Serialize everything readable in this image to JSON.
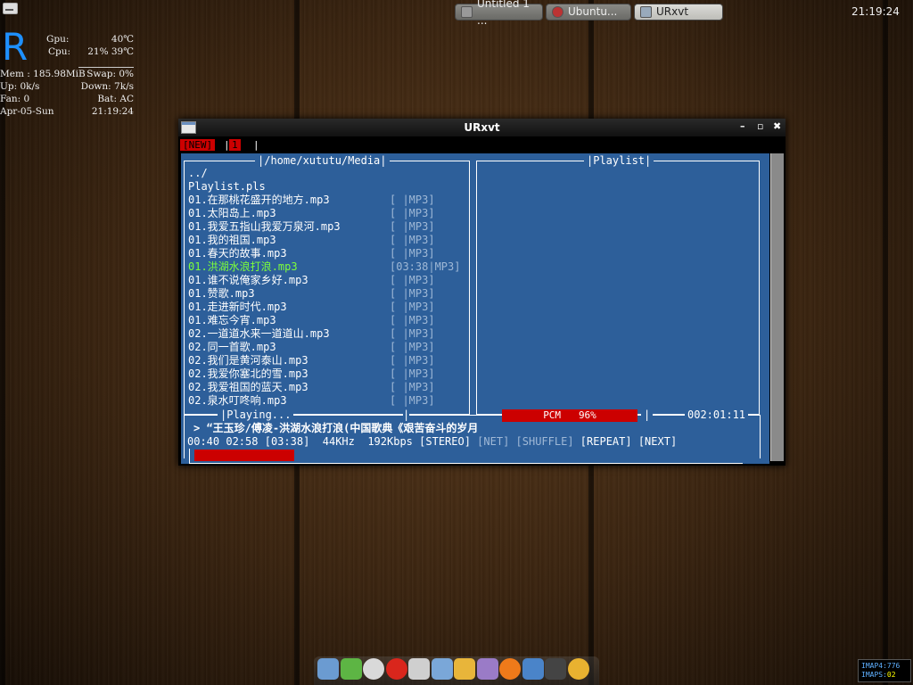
{
  "desktop": {
    "clock": "21:19:24",
    "taskbar": [
      {
        "label": "Untitled 1 ...",
        "icon": "document-icon",
        "active": false
      },
      {
        "label": "Ubuntu...",
        "icon": "ubuntu-icon",
        "active": false
      },
      {
        "label": "URxvt",
        "icon": "terminal-icon",
        "active": true
      }
    ]
  },
  "conky": {
    "logo": "R",
    "gpu_label": "Gpu:",
    "gpu_value": "40℃",
    "cpu_label": "Cpu:",
    "cpu_value": "21% 39℃",
    "mem_label": "Mem : 185.98MiB",
    "swap_label": "Swap: 0%",
    "up_label": "Up: 0k/s",
    "down_label": "Down: 7k/s",
    "fan_label": "Fan: 0",
    "bat_label": "Bat: AC",
    "date": "Apr-05-Sun",
    "time": "21:19:24"
  },
  "window": {
    "title": "URxvt",
    "tabs": [
      "NEW",
      "1"
    ]
  },
  "browser": {
    "title": "/home/xututu/Media",
    "rows": [
      {
        "name": "../",
        "tag": "",
        "current": false
      },
      {
        "name": "Playlist.pls",
        "tag": "",
        "current": false
      },
      {
        "name": "01.在那桃花盛开的地方.mp3",
        "tag": "[      |MP3]",
        "current": false
      },
      {
        "name": "01.太阳岛上.mp3",
        "tag": "[      |MP3]",
        "current": false
      },
      {
        "name": "01.我爱五指山我爱万泉河.mp3",
        "tag": "[      |MP3]",
        "current": false
      },
      {
        "name": "01.我的祖国.mp3",
        "tag": "[      |MP3]",
        "current": false
      },
      {
        "name": "01.春天的故事.mp3",
        "tag": "[      |MP3]",
        "current": false
      },
      {
        "name_hl": "01.洪湖水浪打浪",
        "name": ".mp3",
        "tag": "[03:38|MP3]",
        "current": true
      },
      {
        "name": "01.谁不说俺家乡好.mp3",
        "tag": "[      |MP3]",
        "current": false
      },
      {
        "name": "01.赞歌.mp3",
        "tag": "[      |MP3]",
        "current": false
      },
      {
        "name": "01.走进新时代.mp3",
        "tag": "[      |MP3]",
        "current": false
      },
      {
        "name": "01.难忘今宵.mp3",
        "tag": "[      |MP3]",
        "current": false
      },
      {
        "name": "02.一道道水来一道道山.mp3",
        "tag": "[      |MP3]",
        "current": false
      },
      {
        "name": "02.同一首歌.mp3",
        "tag": "[      |MP3]",
        "current": false
      },
      {
        "name": "02.我们是黄河泰山.mp3",
        "tag": "[      |MP3]",
        "current": false
      },
      {
        "name": "02.我爱你塞北的雪.mp3",
        "tag": "[      |MP3]",
        "current": false
      },
      {
        "name": "02.我爱祖国的蓝天.mp3",
        "tag": "[      |MP3]",
        "current": false
      },
      {
        "name": "02.泉水叮咚响.mp3",
        "tag": "[      |MP3]",
        "current": false
      }
    ]
  },
  "playlist": {
    "title": "Playlist"
  },
  "status": {
    "playing_label": "Playing...",
    "volume_label": "PCM",
    "volume_value": "96%",
    "volume_fraction": 0.96,
    "total_time": "002:01:11",
    "now_playing": "> “王玉珍/傅凌-洪湖水浪打浪(中国歌典《艰苦奋斗的岁月",
    "elapsed": "00:40",
    "remaining": "02:58",
    "duration": "[03:38]",
    "samplerate": "44KHz",
    "bitrate": "192Kbps",
    "flag_stereo": "[STEREO]",
    "flag_net": "[NET]",
    "flag_shuffle": "[SHUFFLE]",
    "flag_repeat": "[REPEAT]",
    "flag_next": "[NEXT]",
    "progress_fraction": 0.18
  },
  "imap": {
    "line1_label": "IMAP4:",
    "line1_value": "776",
    "line2_label": "IMAPS:",
    "line2_value": "02"
  },
  "dock": {
    "icons": [
      "folder-icon",
      "leaf-editor-icon",
      "pidgin-icon",
      "opera-icon",
      "settings-icon",
      "music-player-icon",
      "colors-icon",
      "ghost-icon",
      "firefox-icon",
      "thunderbird-icon",
      "terminal-icon",
      "chrome-icon"
    ],
    "colors": [
      "#6b9bd1",
      "#5db544",
      "#d9d9d9",
      "#d9261c",
      "#cfcfcf",
      "#7aa7d8",
      "#e8b53a",
      "#9a7bc7",
      "#ef7a1a",
      "#4a84c9",
      "#444444",
      "#e9b230"
    ]
  }
}
